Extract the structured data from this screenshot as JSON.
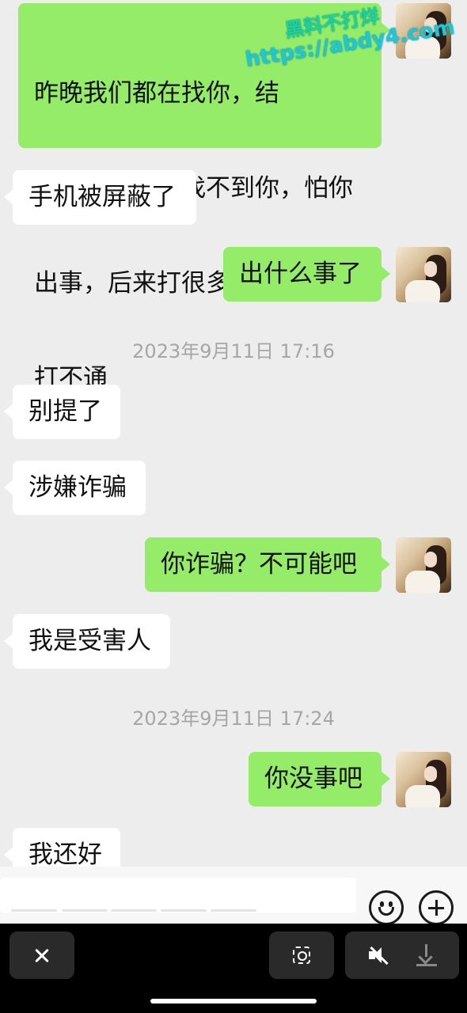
{
  "watermark": {
    "line1": "黑料不打烊",
    "line2": "https://abdy4.com"
  },
  "messages": [
    {
      "side": "out",
      "lines": [
        "昨晚我们都在找你，结",
        "　　打电话说找不到你，怕你",
        "出事，后来打很多电话给你都",
        "打不通"
      ]
    },
    {
      "side": "in",
      "lines": [
        "手机被屏蔽了"
      ]
    },
    {
      "side": "out",
      "lines": [
        "出什么事了"
      ]
    },
    {
      "side": "time",
      "text": "2023年9月11日 17:16"
    },
    {
      "side": "in",
      "lines": [
        "别提了"
      ]
    },
    {
      "side": "in",
      "lines": [
        "涉嫌诈骗"
      ]
    },
    {
      "side": "out",
      "lines": [
        "你诈骗？不可能吧"
      ]
    },
    {
      "side": "in",
      "lines": [
        "我是受害人"
      ]
    },
    {
      "side": "time",
      "text": "2023年9月11日 17:24"
    },
    {
      "side": "out",
      "lines": [
        "你没事吧"
      ]
    },
    {
      "side": "in",
      "lines": [
        "我还好"
      ]
    }
  ],
  "m": {
    "m0l0": "昨晚我们都在找你，结",
    "m0l1": "　　打电话说找不到你，怕你",
    "m0l2": "出事，后来打很多电话给你都",
    "m0l3": "打不通",
    "m1": "手机被屏蔽了",
    "m2": "出什么事了",
    "t1": "2023年9月11日 17:16",
    "m3": "别提了",
    "m4": "涉嫌诈骗",
    "m5": "你诈骗？不可能吧",
    "m6": "我是受害人",
    "t2": "2023年9月11日 17:24",
    "m7": "你没事吧",
    "m8": "我还好"
  },
  "icons": {
    "emoji": "emoji-icon",
    "plus": "plus-icon",
    "close": "close-icon",
    "scan": "scan-icon",
    "mute": "mute-icon",
    "download": "download-icon"
  },
  "colors": {
    "outgoing_bubble": "#95ec69",
    "incoming_bubble": "#ffffff",
    "chat_bg": "#ededed"
  }
}
